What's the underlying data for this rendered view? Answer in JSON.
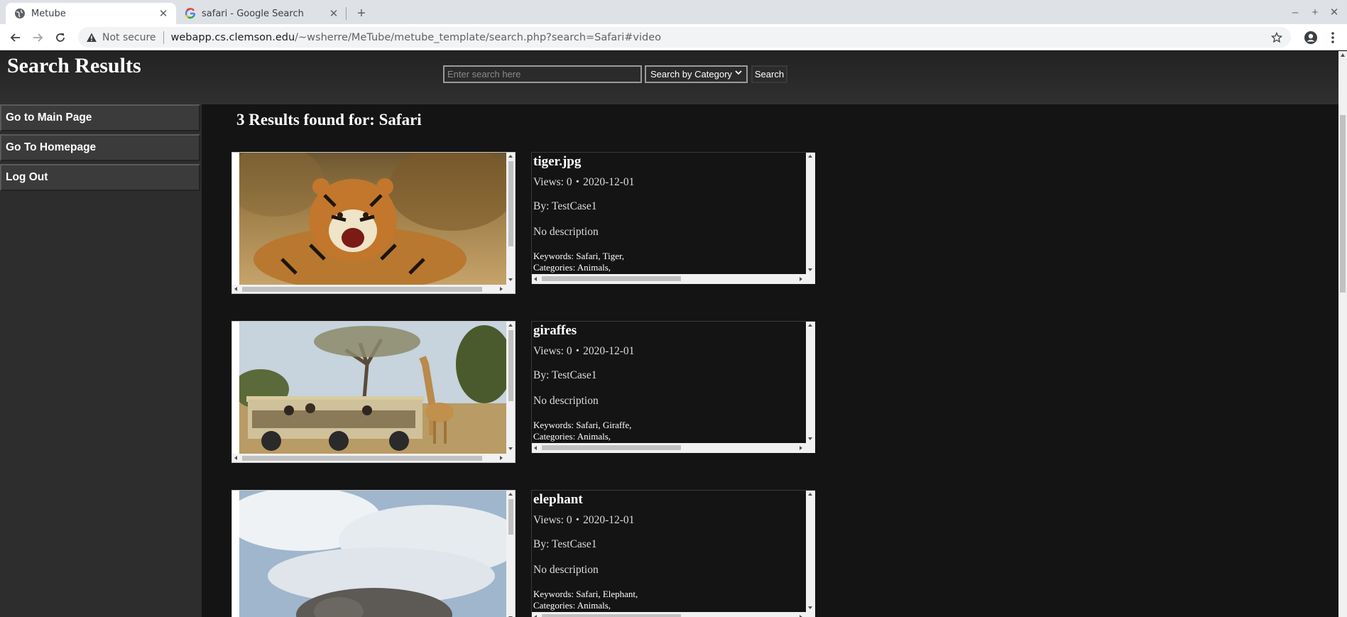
{
  "browser": {
    "tabs": [
      {
        "title": "Metube",
        "active": true
      },
      {
        "title": "safari - Google Search",
        "active": false
      }
    ],
    "address_bar": {
      "security_label": "Not secure",
      "url_host": "webapp.cs.clemson.edu",
      "url_path": "/~wsherre/MeTube/metube_template/search.php?search=Safari#video"
    }
  },
  "header": {
    "title": "Search Results",
    "search_placeholder": "Enter search here",
    "category_select": "Search by Category",
    "search_button": "Search"
  },
  "sidebar": {
    "items": [
      {
        "label": "Go to Main Page"
      },
      {
        "label": "Go To Homepage"
      },
      {
        "label": "Log Out"
      }
    ]
  },
  "results": {
    "heading": "3 Results found for: Safari",
    "items": [
      {
        "title": "tiger.jpg",
        "views_date": "Views: 0・2020-12-01",
        "by": "By: TestCase1",
        "description": "No description",
        "keywords": "Keywords: Safari, Tiger,",
        "categories": "Categories: Animals,",
        "thumbnail": "tiger-photo"
      },
      {
        "title": "giraffes",
        "views_date": "Views: 0・2020-12-01",
        "by": "By: TestCase1",
        "description": "No description",
        "keywords": "Keywords: Safari, Giraffe,",
        "categories": "Categories: Animals,",
        "thumbnail": "giraffe-safari-photo"
      },
      {
        "title": "elephant",
        "views_date": "Views: 0・2020-12-01",
        "by": "By: TestCase1",
        "description": "No description",
        "keywords": "Keywords: Safari, Elephant,",
        "categories": "Categories: Animals,",
        "thumbnail": "elephant-photo"
      }
    ]
  },
  "colors": {
    "page_bg": "#141414",
    "header_bg": "#2a2a2a",
    "sidebar_bg": "#2d2d2d",
    "sidebar_item_bg": "#3b3b3b"
  }
}
